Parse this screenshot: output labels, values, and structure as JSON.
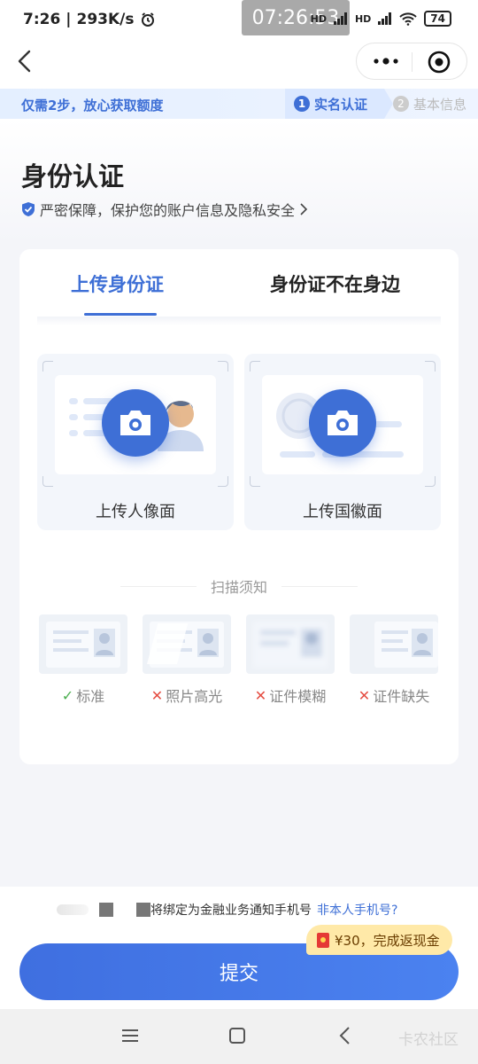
{
  "status_bar": {
    "time": "7:26",
    "speed": "293K/s",
    "clock_overlay": "07:26:53",
    "battery": "74",
    "signal_labels": [
      "HD",
      "HD"
    ]
  },
  "nav": {
    "back_icon": "chevron-left-icon",
    "more_icon": "more-dots-icon",
    "close_icon": "target-close-icon"
  },
  "steps": {
    "tip": "仅需2步，放心获取额度",
    "step1": {
      "num": "1",
      "label": "实名认证"
    },
    "step2": {
      "num": "2",
      "label": "基本信息"
    }
  },
  "header": {
    "title": "身份认证",
    "security_text": "严密保障，保护您的账户信息及隐私安全",
    "security_icon": "shield-check-icon"
  },
  "tabs": {
    "active": "上传身份证",
    "inactive": "身份证不在身边"
  },
  "uploads": [
    {
      "label": "上传人像面",
      "icon": "camera-icon"
    },
    {
      "label": "上传国徽面",
      "icon": "camera-icon"
    }
  ],
  "scan": {
    "title": "扫描须知",
    "samples": [
      {
        "label": "标准",
        "mark": "✓",
        "status": "ok"
      },
      {
        "label": "照片高光",
        "mark": "✕",
        "status": "bad"
      },
      {
        "label": "证件模糊",
        "mark": "✕",
        "status": "bad"
      },
      {
        "label": "证件缺失",
        "mark": "✕",
        "status": "bad"
      }
    ]
  },
  "bottom": {
    "notice_text": "将绑定为金融业务通知手机号",
    "notice_link": "非本人手机号?",
    "cashback": "¥30，完成返现金",
    "submit": "提交"
  },
  "system_nav": {
    "watermark": "卡农社区"
  },
  "colors": {
    "primary": "#3e6fd6",
    "ok": "#4caf50",
    "bad": "#e54d42",
    "cashback_bg": "#ffe9a8"
  }
}
